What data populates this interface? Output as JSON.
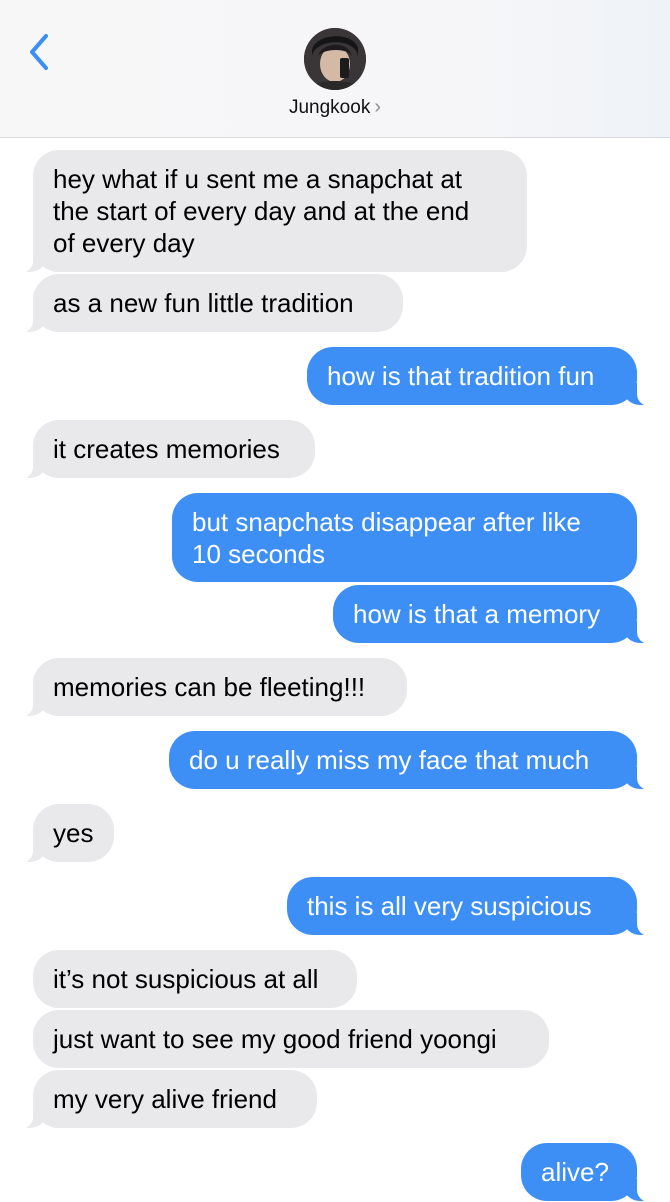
{
  "header": {
    "contact_name": "Jungkook",
    "chevron": "›",
    "back_icon": "chevron-left-icon"
  },
  "colors": {
    "incoming_bubble": "#e9e9eb",
    "outgoing_bubble": "#3d8ff6",
    "back_accent": "#3d8ff6"
  },
  "messages": [
    {
      "dir": "in",
      "text": "hey what if u sent me a snapchat at\nthe start of every day and at the end\nof every day"
    },
    {
      "dir": "in",
      "text": "as a new fun little tradition"
    },
    {
      "dir": "out",
      "text": "how is that tradition fun"
    },
    {
      "dir": "in",
      "text": "it creates memories"
    },
    {
      "dir": "out",
      "text": "but snapchats disappear after like\n10 seconds"
    },
    {
      "dir": "out",
      "text": "how is that a memory"
    },
    {
      "dir": "in",
      "text": "memories can be fleeting!!!"
    },
    {
      "dir": "out",
      "text": "do u really miss my face that much"
    },
    {
      "dir": "in",
      "text": "yes"
    },
    {
      "dir": "out",
      "text": "this is all very suspicious"
    },
    {
      "dir": "in",
      "text": "it’s not suspicious at all"
    },
    {
      "dir": "in",
      "text": "just want to see my good friend yoongi"
    },
    {
      "dir": "in",
      "text": "my very alive friend"
    },
    {
      "dir": "out",
      "text": "alive?"
    }
  ]
}
